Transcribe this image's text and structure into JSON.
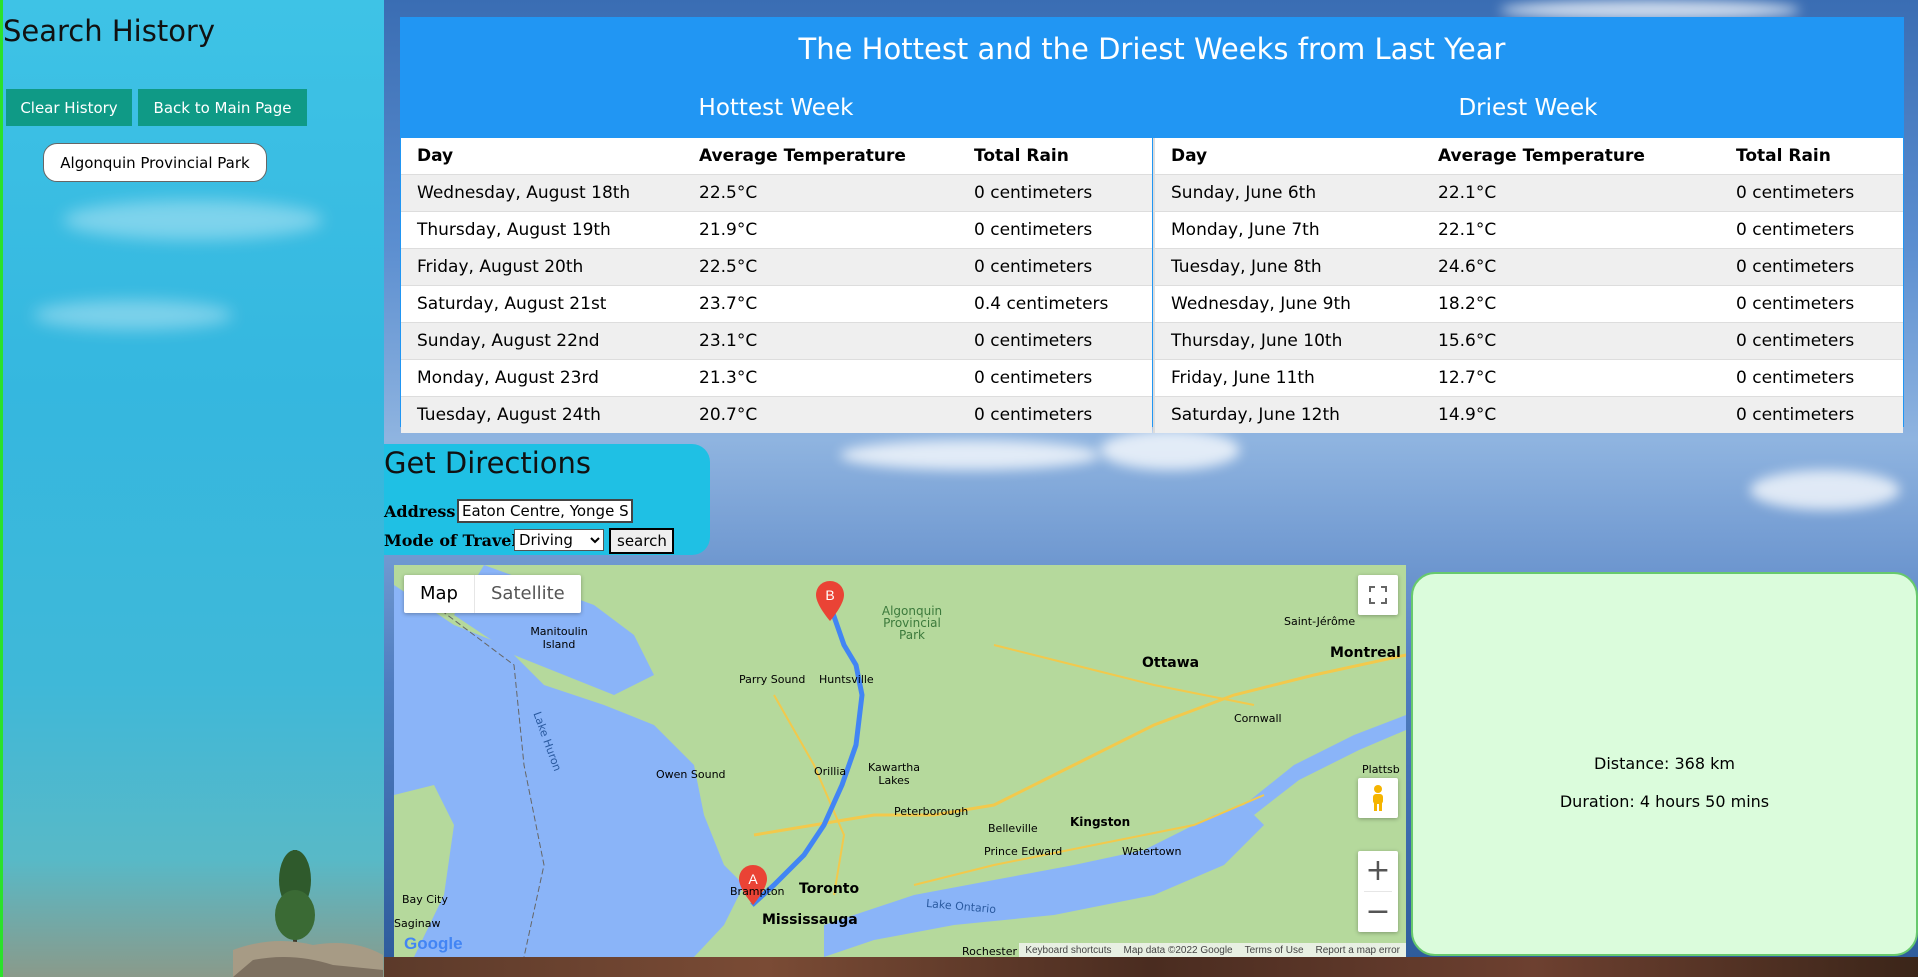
{
  "sidebar": {
    "title": "Search History",
    "clear_label": "Clear History",
    "back_label": "Back to Main Page",
    "history": [
      "Algonquin Provincial Park"
    ]
  },
  "weather": {
    "title": "The Hottest and the Driest Weeks from Last Year",
    "hottest": {
      "heading": "Hottest Week",
      "columns": [
        "Day",
        "Average Temperature",
        "Total Rain"
      ],
      "rows": [
        [
          "Wednesday, August 18th",
          "22.5°C",
          "0 centimeters"
        ],
        [
          "Thursday, August 19th",
          "21.9°C",
          "0 centimeters"
        ],
        [
          "Friday, August 20th",
          "22.5°C",
          "0 centimeters"
        ],
        [
          "Saturday, August 21st",
          "23.7°C",
          "0.4 centimeters"
        ],
        [
          "Sunday, August 22nd",
          "23.1°C",
          "0 centimeters"
        ],
        [
          "Monday, August 23rd",
          "21.3°C",
          "0 centimeters"
        ],
        [
          "Tuesday, August 24th",
          "20.7°C",
          "0 centimeters"
        ]
      ]
    },
    "driest": {
      "heading": "Driest Week",
      "columns": [
        "Day",
        "Average Temperature",
        "Total Rain"
      ],
      "rows": [
        [
          "Sunday, June 6th",
          "22.1°C",
          "0 centimeters"
        ],
        [
          "Monday, June 7th",
          "22.1°C",
          "0 centimeters"
        ],
        [
          "Tuesday, June 8th",
          "24.6°C",
          "0 centimeters"
        ],
        [
          "Wednesday, June 9th",
          "18.2°C",
          "0 centimeters"
        ],
        [
          "Thursday, June 10th",
          "15.6°C",
          "0 centimeters"
        ],
        [
          "Friday, June 11th",
          "12.7°C",
          "0 centimeters"
        ],
        [
          "Saturday, June 12th",
          "14.9°C",
          "0 centimeters"
        ]
      ]
    }
  },
  "directions": {
    "title": "Get Directions",
    "address_label": "Address",
    "address_value": "Eaton Centre, Yonge Street",
    "mode_label": "Mode of Travel",
    "mode_value": "Driving",
    "search_label": "search"
  },
  "map": {
    "map_label": "Map",
    "satellite_label": "Satellite",
    "marker_a": "A",
    "marker_b": "B",
    "logo": "Google",
    "footer": [
      "Keyboard shortcuts",
      "Map data ©2022 Google",
      "Terms of Use",
      "Report a map error"
    ],
    "places": [
      "Algonquin Provincial Park",
      "Ottawa",
      "Montreal",
      "Saint-Jérôme",
      "Manitoulin Island",
      "Parry Sound",
      "Huntsville",
      "Owen Sound",
      "Orillia",
      "Kawartha Lakes",
      "Peterborough",
      "Belleville",
      "Kingston",
      "Prince Edward",
      "Watertown",
      "Cornwall",
      "Brampton",
      "Toronto",
      "Mississauga",
      "Lake Ontario",
      "Lake Huron",
      "Bay City",
      "Saginaw",
      "Rochester",
      "Plattsb"
    ]
  },
  "route": {
    "distance": "Distance: 368 km",
    "duration": "Duration: 4 hours 50 mins"
  },
  "colors": {
    "weather_bg": "#2196f3",
    "teal_button": "#0f9a86",
    "info_bg": "#dbfcdc",
    "directions_bg": "#1fc0e4"
  }
}
